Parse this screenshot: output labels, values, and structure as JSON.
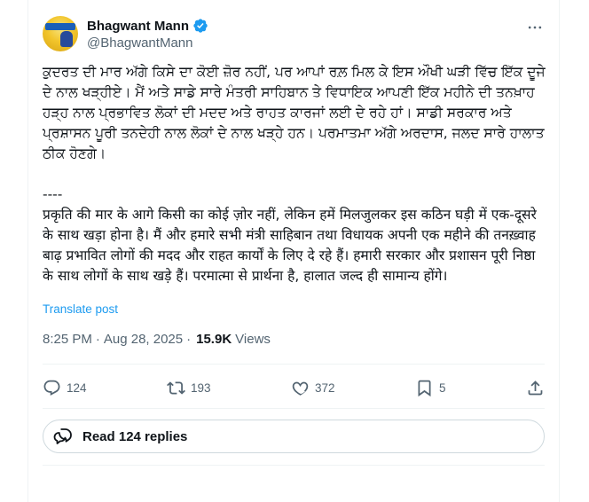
{
  "author": {
    "name": "Bhagwant Mann",
    "handle": "@BhagwantMann"
  },
  "post": {
    "text": "ਕੁਦਰਤ ਦੀ ਮਾਰ ਅੱਗੇ ਕਿਸੇ ਦਾ ਕੋਈ ਜ਼ੋਰ ਨਹੀਂ, ਪਰ ਆਪਾਂ ਰਲ਼ ਮਿਲ ਕੇ ਇਸ ਔਖੀ ਘੜੀ ਵਿੱਚ ਇੱਕ ਦੂਜੇ ਦੇ ਨਾਲ ਖੜ੍ਹੀਏ। ਮੈਂ ਅਤੇ ਸਾਡੇ ਸਾਰੇ ਮੰਤਰੀ ਸਾਹਿਬਾਨ ਤੇ ਵਿਧਾਇਕ ਆਪਣੀ ਇੱਕ ਮਹੀਨੇ ਦੀ ਤਨਖ਼ਾਹ ਹੜ੍ਹ ਨਾਲ ਪ੍ਰਭਾਵਿਤ ਲੋਕਾਂ ਦੀ ਮਦਦ ਅਤੇ ਰਾਹਤ ਕਾਰਜਾਂ ਲਈ ਦੇ ਰਹੇ ਹਾਂ। ਸਾਡੀ ਸਰਕਾਰ ਅਤੇ ਪ੍ਰਸ਼ਾਸਨ ਪੂਰੀ ਤਨਦੇਹੀ ਨਾਲ ਲੋਕਾਂ ਦੇ ਨਾਲ ਖੜ੍ਹੇ ਹਨ। ਪਰਮਾਤਮਾ ਅੱਗੇ ਅਰਦਾਸ, ਜਲਦ ਸਾਰੇ ਹਾਲਾਤ ਠੀਕ ਹੋਣਗੇ।\n\n----\nप्रकृति की मार के आगे किसी का कोई ज़ोर नहीं, लेकिन हमें मिलजुलकर इस कठिन घड़ी में एक-दूसरे के साथ खड़ा होना है। मैं और हमारे सभी मंत्री साहिबान तथा विधायक अपनी एक महीने की तनख़्वाह बाढ़ प्रभावित लोगों की मदद और राहत कार्यों के लिए दे रहे हैं। हमारी सरकार और प्रशासन पूरी निष्ठा के साथ लोगों के साथ खड़े हैं। परमात्मा से प्रार्थना है, हालात जल्द ही सामान्य होंगे।",
    "translate_label": "Translate post",
    "time": "8:25 PM",
    "separator": "·",
    "date": "Aug 28, 2025",
    "views_count": "15.9K",
    "views_label": "Views"
  },
  "actions": {
    "replies": "124",
    "reposts": "193",
    "likes": "372",
    "bookmarks": "5"
  },
  "read_replies_label": "Read 124 replies",
  "icons": {
    "verified": "verified-badge-icon",
    "more": "more-dots-icon",
    "reply": "reply-icon",
    "repost": "repost-icon",
    "like": "heart-icon",
    "bookmark": "bookmark-icon",
    "share": "share-icon",
    "replies": "speech-bubbles-icon"
  },
  "colors": {
    "accent": "#1d9bf0",
    "text": "#0f1419",
    "muted": "#536471",
    "border": "#eff3f4"
  }
}
